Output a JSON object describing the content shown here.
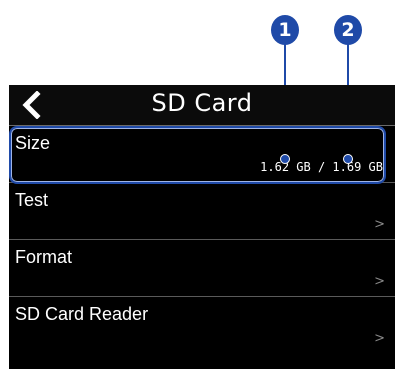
{
  "header": {
    "title": "SD Card",
    "back_icon": "chevron-left-icon"
  },
  "rows": [
    {
      "label": "Size",
      "value": "1.62 GB / 1.69 GB"
    },
    {
      "label": "Test",
      "chevron": ">"
    },
    {
      "label": "Format",
      "chevron": ">"
    },
    {
      "label": "SD Card Reader",
      "chevron": ">"
    }
  ],
  "callouts": [
    "1",
    "2"
  ],
  "colors": {
    "accent": "#1f4aa8",
    "background": "#000000",
    "text": "#ffffff"
  }
}
